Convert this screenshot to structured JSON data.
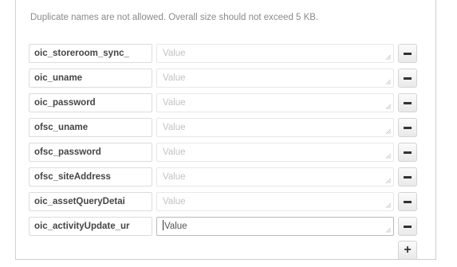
{
  "notice": "Duplicate names are not allowed. Overall size should not exceed 5 KB.",
  "rows": [
    {
      "key": "oic_storeroom_sync_",
      "value": "",
      "placeholder": "Value",
      "active": false
    },
    {
      "key": "oic_uname",
      "value": "",
      "placeholder": "Value",
      "active": false
    },
    {
      "key": "oic_password",
      "value": "",
      "placeholder": "Value",
      "active": false
    },
    {
      "key": "ofsc_uname",
      "value": "",
      "placeholder": "Value",
      "active": false
    },
    {
      "key": "ofsc_password",
      "value": "",
      "placeholder": "Value",
      "active": false
    },
    {
      "key": "ofsc_siteAddress",
      "value": "",
      "placeholder": "Value",
      "active": false
    },
    {
      "key": "oic_assetQueryDetai",
      "value": "",
      "placeholder": "Value",
      "active": false
    },
    {
      "key": "oic_activityUpdate_ur",
      "value": "",
      "placeholder": "Value",
      "active": true
    }
  ],
  "icons": {
    "remove": "minus-icon",
    "add": "plus-icon",
    "resize": "resize-grip-icon"
  },
  "add_label": "+"
}
